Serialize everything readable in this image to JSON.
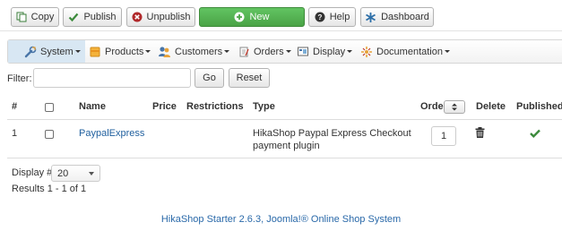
{
  "toolbar": {
    "copy_label": "Copy",
    "publish_label": "Publish",
    "unpublish_label": "Unpublish",
    "new_label": "New",
    "help_label": "Help",
    "dashboard_label": "Dashboard"
  },
  "menu": {
    "items": [
      {
        "label": "System",
        "icon": "wrench-icon"
      },
      {
        "label": "Products",
        "icon": "products-icon"
      },
      {
        "label": "Customers",
        "icon": "customers-icon"
      },
      {
        "label": "Orders",
        "icon": "orders-icon"
      },
      {
        "label": "Display",
        "icon": "display-icon"
      },
      {
        "label": "Documentation",
        "icon": "documentation-icon"
      }
    ]
  },
  "filter": {
    "label": "Filter:",
    "value": "",
    "placeholder": "",
    "go_label": "Go",
    "reset_label": "Reset"
  },
  "table": {
    "headers": {
      "num": "#",
      "name": "Name",
      "price": "Price",
      "restrictions": "Restrictions",
      "type": "Type",
      "order": "Order",
      "delete": "Delete",
      "published": "Published"
    },
    "rows": [
      {
        "num": "1",
        "name": "PaypalExpress",
        "price": "",
        "restrictions": "",
        "type_line1": "HikaShop Paypal Express Checkout",
        "type_line2": "payment plugin",
        "order": "1",
        "published": true
      }
    ]
  },
  "pagination": {
    "display_label": "Display #",
    "display_value": "20",
    "results_text": "Results 1 - 1 of 1"
  },
  "footer": {
    "text": "HikaShop Starter 2.6.3, Joomla!® Online Shop System"
  },
  "colors": {
    "new_button": "#4aa346",
    "link": "#1f5f9e",
    "published_check": "#3b8a3b",
    "menu_active": "#d8e7f3"
  }
}
